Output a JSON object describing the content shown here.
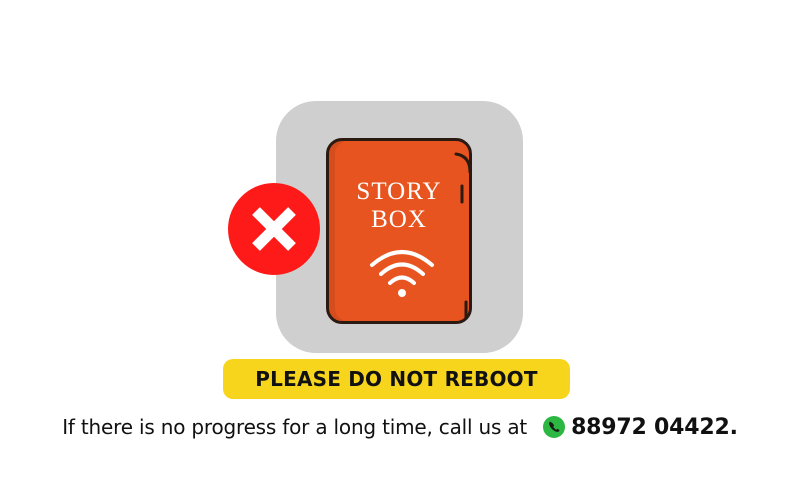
{
  "device": {
    "title_line1": "STORY",
    "title_line2": "BOX",
    "color": "#e8541f",
    "icon": "wifi-icon"
  },
  "status": {
    "icon": "error-x-icon",
    "color": "#ff1a1a"
  },
  "warning": {
    "text": "PLEASE DO NOT REBOOT",
    "color": "#f7d51d"
  },
  "help": {
    "text": "If there is no progress for a long time, call us at",
    "phone_icon": "whatsapp-phone-icon",
    "phone_icon_color": "#2bb741",
    "phone_number": "88972 04422."
  }
}
